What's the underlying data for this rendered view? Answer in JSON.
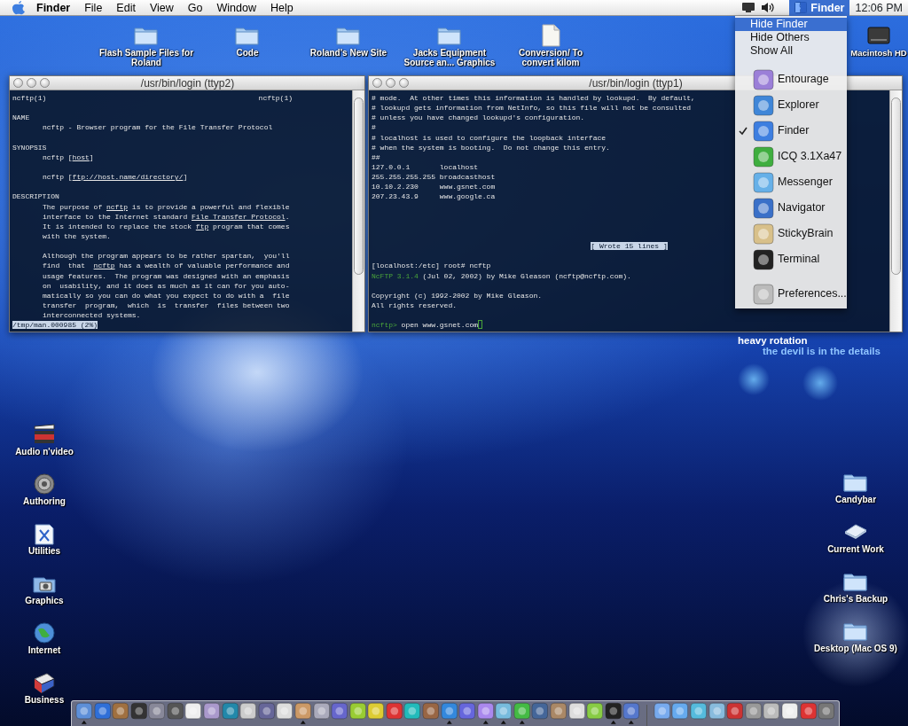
{
  "menubar": {
    "menus": [
      {
        "label": "Finder",
        "kind": "app-name"
      },
      {
        "label": "File",
        "kind": "menu"
      },
      {
        "label": "Edit",
        "kind": "menu"
      },
      {
        "label": "View",
        "kind": "menu"
      },
      {
        "label": "Go",
        "kind": "menu"
      },
      {
        "label": "Window",
        "kind": "menu"
      },
      {
        "label": "Help",
        "kind": "menu"
      }
    ],
    "app_switcher": {
      "label": "Finder",
      "open": true
    },
    "clock": "12:06 PM"
  },
  "desktop_top_icons": [
    {
      "label": "Flash Sample Files for Roland",
      "kind": "folder"
    },
    {
      "label": "Code",
      "kind": "folder"
    },
    {
      "label": "Roland's New Site",
      "kind": "folder"
    },
    {
      "label": "Jacks Equipment Source an... Graphics",
      "kind": "folder"
    },
    {
      "label": "Conversion/ To convert kilom",
      "kind": "document"
    }
  ],
  "disk_icon": {
    "label": "Macintosh HD",
    "kind": "disk"
  },
  "terminals": [
    {
      "title": "/usr/bin/login (ttyp2)",
      "lines": [
        {
          "kind": "header",
          "left": "ncftp(1)",
          "right": "ncftp(1)"
        },
        {
          "kind": "blank"
        },
        {
          "kind": "text",
          "spans": [
            {
              "text": "NAME",
              "kind": "text"
            }
          ]
        },
        {
          "kind": "indented",
          "spans": [
            {
              "text": "ncftp - Browser program for the File Transfer Protocol",
              "kind": "text"
            }
          ]
        },
        {
          "kind": "blank"
        },
        {
          "kind": "text",
          "spans": [
            {
              "text": "SYNOPSIS",
              "kind": "text"
            }
          ]
        },
        {
          "kind": "indented",
          "spans": [
            {
              "text": "ncftp [",
              "kind": "text"
            },
            {
              "text": "host",
              "kind": "link"
            },
            {
              "text": "]",
              "kind": "text"
            }
          ]
        },
        {
          "kind": "blank"
        },
        {
          "kind": "indented",
          "spans": [
            {
              "text": "ncftp [",
              "kind": "text"
            },
            {
              "text": "ftp://host.name/directory/",
              "kind": "link"
            },
            {
              "text": "]",
              "kind": "text"
            }
          ]
        },
        {
          "kind": "blank"
        },
        {
          "kind": "text",
          "spans": [
            {
              "text": "DESCRIPTION",
              "kind": "text"
            }
          ]
        },
        {
          "kind": "indented",
          "spans": [
            {
              "text": "The purpose of ",
              "kind": "text"
            },
            {
              "text": "ncftp",
              "kind": "link"
            },
            {
              "text": " is to provide a powerful and flexible",
              "kind": "text"
            }
          ]
        },
        {
          "kind": "indented",
          "spans": [
            {
              "text": "interface to the Internet standard ",
              "kind": "text"
            },
            {
              "text": "File Transfer Protocol",
              "kind": "link"
            },
            {
              "text": ".",
              "kind": "text"
            }
          ]
        },
        {
          "kind": "indented",
          "spans": [
            {
              "text": "It is intended to replace the stock ",
              "kind": "text"
            },
            {
              "text": "ftp",
              "kind": "link"
            },
            {
              "text": " program that comes",
              "kind": "text"
            }
          ]
        },
        {
          "kind": "indented",
          "spans": [
            {
              "text": "with the system.",
              "kind": "text"
            }
          ]
        },
        {
          "kind": "blank"
        },
        {
          "kind": "indented",
          "spans": [
            {
              "text": "Although the program appears to be rather spartan,  you'll",
              "kind": "text"
            }
          ]
        },
        {
          "kind": "indented",
          "spans": [
            {
              "text": "find  that  ",
              "kind": "text"
            },
            {
              "text": "ncftp",
              "kind": "link"
            },
            {
              "text": " has a wealth of valuable performance and",
              "kind": "text"
            }
          ]
        },
        {
          "kind": "indented",
          "spans": [
            {
              "text": "usage features.  The program was designed with an emphasis",
              "kind": "text"
            }
          ]
        },
        {
          "kind": "indented",
          "spans": [
            {
              "text": "on  usability, and it does as much as it can for you auto-",
              "kind": "text"
            }
          ]
        },
        {
          "kind": "indented",
          "spans": [
            {
              "text": "matically so you can do what you expect to do with a  file",
              "kind": "text"
            }
          ]
        },
        {
          "kind": "indented",
          "spans": [
            {
              "text": "transfer  program,  which  is  transfer  files between two",
              "kind": "text"
            }
          ]
        },
        {
          "kind": "indented",
          "spans": [
            {
              "text": "interconnected systems.",
              "kind": "text"
            }
          ]
        },
        {
          "kind": "status",
          "text": "/tmp/man.000985 (2%)"
        }
      ]
    },
    {
      "title": "/usr/bin/login (ttyp1)",
      "lines": [
        {
          "kind": "text",
          "spans": [
            {
              "text": "# mode.  At other times this information is handled by lookupd.  By default,",
              "kind": "text"
            }
          ]
        },
        {
          "kind": "text",
          "spans": [
            {
              "text": "# lookupd gets information from NetInfo, so this file will not be consulted",
              "kind": "text"
            }
          ]
        },
        {
          "kind": "text",
          "spans": [
            {
              "text": "# unless you have changed lookupd's configuration.",
              "kind": "text"
            }
          ]
        },
        {
          "kind": "text",
          "spans": [
            {
              "text": "#",
              "kind": "text"
            }
          ]
        },
        {
          "kind": "text",
          "spans": [
            {
              "text": "# localhost is used to configure the loopback interface",
              "kind": "text"
            }
          ]
        },
        {
          "kind": "text",
          "spans": [
            {
              "text": "# when the system is booting.  Do not change this entry.",
              "kind": "text"
            }
          ]
        },
        {
          "kind": "text",
          "spans": [
            {
              "text": "##",
              "kind": "text"
            }
          ]
        },
        {
          "kind": "text",
          "spans": [
            {
              "text": "127.0.0.1       localhost",
              "kind": "text"
            }
          ]
        },
        {
          "kind": "text",
          "spans": [
            {
              "text": "255.255.255.255 broadcasthost",
              "kind": "text"
            }
          ]
        },
        {
          "kind": "text",
          "spans": [
            {
              "text": "10.10.2.230     www.gsnet.com",
              "kind": "text"
            }
          ]
        },
        {
          "kind": "text",
          "spans": [
            {
              "text": "207.23.43.9     www.google.ca",
              "kind": "text"
            }
          ]
        },
        {
          "kind": "blank"
        },
        {
          "kind": "blank"
        },
        {
          "kind": "blank"
        },
        {
          "kind": "blank"
        },
        {
          "kind": "message",
          "text": "[ Wrote 15 lines ]"
        },
        {
          "kind": "blank"
        },
        {
          "kind": "text",
          "spans": [
            {
              "text": "[localhost:/etc] root# ncftp",
              "kind": "text"
            }
          ]
        },
        {
          "kind": "text",
          "spans": [
            {
              "text": "NcFTP 3.1.4",
              "kind": "program-name"
            },
            {
              "text": " (Jul 02, 2002) by Mike Gleason (ncftp@ncftp.com).",
              "kind": "text"
            }
          ]
        },
        {
          "kind": "blank"
        },
        {
          "kind": "text",
          "spans": [
            {
              "text": "Copyright (c) 1992-2002 by Mike Gleason.",
              "kind": "text"
            }
          ]
        },
        {
          "kind": "text",
          "spans": [
            {
              "text": "All rights reserved.",
              "kind": "text"
            }
          ]
        },
        {
          "kind": "blank"
        },
        {
          "kind": "text",
          "cursor": true,
          "spans": [
            {
              "text": "ncftp>",
              "kind": "program-name"
            },
            {
              "text": " open www.gsnet.com",
              "kind": "text"
            }
          ]
        }
      ]
    }
  ],
  "app_menu": [
    {
      "kind": "command",
      "label": "Hide Finder",
      "selected": true
    },
    {
      "kind": "command",
      "label": "Hide Others",
      "selected": false
    },
    {
      "kind": "command",
      "label": "Show All",
      "selected": false
    },
    {
      "kind": "separator"
    },
    {
      "kind": "icon-item",
      "label": "Entourage",
      "checked": false
    },
    {
      "kind": "icon-item",
      "label": "Explorer",
      "checked": false
    },
    {
      "kind": "icon-item",
      "label": "Finder",
      "checked": true
    },
    {
      "kind": "icon-item",
      "label": "ICQ 3.1Xa47",
      "checked": false
    },
    {
      "kind": "icon-item",
      "label": "Messenger",
      "checked": false
    },
    {
      "kind": "icon-item",
      "label": "Navigator",
      "checked": false
    },
    {
      "kind": "icon-item",
      "label": "StickyBrain",
      "checked": false
    },
    {
      "kind": "icon-item",
      "label": "Terminal",
      "checked": false
    },
    {
      "kind": "separator"
    },
    {
      "kind": "icon-item",
      "label": "Preferences...",
      "checked": false
    }
  ],
  "wallpaper_caption": [
    {
      "kind": "title",
      "text": "heavy rotation"
    },
    {
      "kind": "subtitle",
      "text": "the devil is in the details"
    }
  ],
  "desktop_left_icons": [
    {
      "label": "Audio n'video",
      "kind": "clapperboard"
    },
    {
      "label": "Authoring",
      "kind": "gear"
    },
    {
      "label": "Utilities",
      "kind": "page"
    },
    {
      "label": "Graphics",
      "kind": "camera"
    },
    {
      "label": "Internet",
      "kind": "globe"
    },
    {
      "label": "Business",
      "kind": "book"
    }
  ],
  "desktop_right_icons": [
    {
      "label": "Candybar",
      "kind": "folder"
    },
    {
      "label": "Current Work",
      "kind": "flat-folder"
    },
    {
      "label": "Chris's Backup",
      "kind": "folder"
    },
    {
      "label": "Desktop (Mac OS 9)",
      "kind": "folder"
    }
  ],
  "dock": {
    "apps": [
      {
        "running": true
      },
      {
        "running": false
      },
      {
        "running": false
      },
      {
        "running": false
      },
      {
        "running": false
      },
      {
        "running": false
      },
      {
        "running": false
      },
      {
        "running": false
      },
      {
        "running": false
      },
      {
        "running": false
      },
      {
        "running": false
      },
      {
        "running": false
      },
      {
        "running": true
      },
      {
        "running": false
      },
      {
        "running": false
      },
      {
        "running": false
      },
      {
        "running": false
      },
      {
        "running": false
      },
      {
        "running": false
      },
      {
        "running": false
      },
      {
        "running": true
      },
      {
        "running": false
      },
      {
        "running": true
      },
      {
        "running": true
      },
      {
        "running": true
      },
      {
        "running": false
      },
      {
        "running": false
      },
      {
        "running": false
      },
      {
        "running": false
      },
      {
        "running": true
      },
      {
        "running": true
      }
    ],
    "documents": [
      {
        "running": false
      },
      {
        "running": false
      },
      {
        "running": false
      },
      {
        "running": false
      },
      {
        "running": false
      },
      {
        "running": false
      },
      {
        "running": false
      },
      {
        "running": false
      },
      {
        "running": false
      },
      {
        "running": false
      }
    ]
  }
}
